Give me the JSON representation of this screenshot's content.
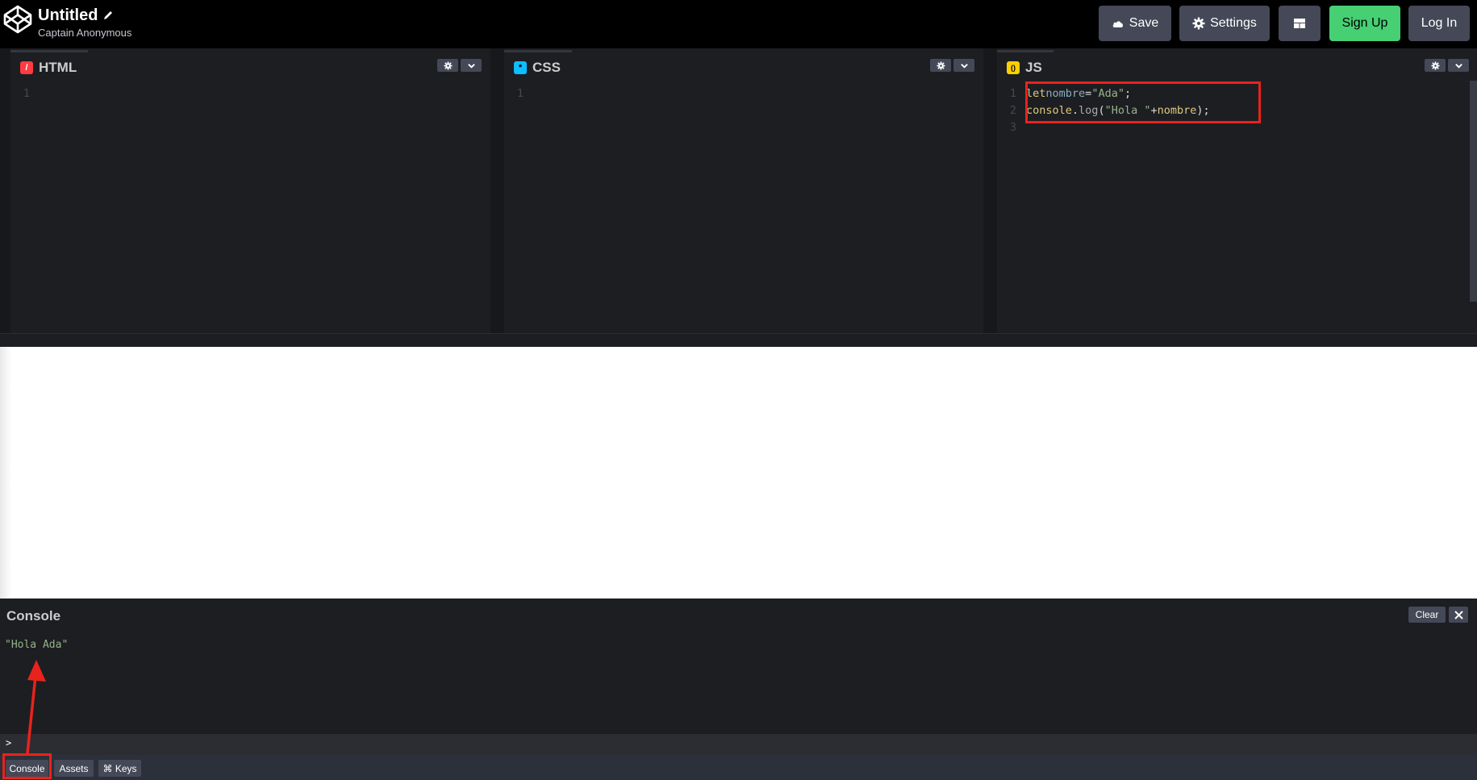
{
  "header": {
    "title": "Untitled",
    "subtitle": "Captain Anonymous",
    "save_label": "Save",
    "settings_label": "Settings",
    "signup_label": "Sign Up",
    "login_label": "Log In"
  },
  "panes": [
    {
      "name": "HTML",
      "icon_char": "/",
      "icon_color": "#ff3c41",
      "lines": [
        "1"
      ]
    },
    {
      "name": "CSS",
      "icon_char": "*",
      "icon_color": "#0ebeff",
      "lines": [
        "1"
      ]
    },
    {
      "name": "JS",
      "icon_char": "()",
      "icon_color": "#fcd000",
      "lines": [
        "1",
        "2",
        "3"
      ]
    }
  ],
  "js_code": {
    "line1": {
      "kw": "let",
      "var": "nombre",
      "op": "=",
      "str": "\"Ada\"",
      "end": ";"
    },
    "line2": {
      "obj": "console",
      "dot": ".",
      "fn": "log",
      "open": "(",
      "str": "\"Hola \"",
      "op": "+",
      "id": "nombre",
      "end": ");"
    }
  },
  "console": {
    "title": "Console",
    "clear_label": "Clear",
    "output": "\"Hola Ada\"",
    "prompt": ">"
  },
  "footer": {
    "console_label": "Console",
    "assets_label": "Assets",
    "keys_label": "⌘ Keys"
  },
  "colors": {
    "accent_green": "#47cf73",
    "annotation_red": "#e8231c"
  }
}
